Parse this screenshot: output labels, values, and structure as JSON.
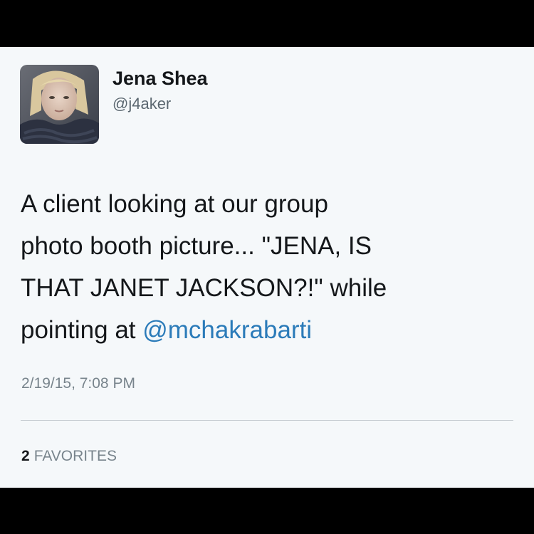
{
  "tweet": {
    "author_name": "Jena Shea",
    "author_handle": "@j4aker",
    "text_lines": [
      "A client looking at our group",
      "photo booth picture... \"JENA, IS",
      "THAT JANET JACKSON?!\" while",
      "pointing at "
    ],
    "mention": "@mchakrabarti",
    "timestamp": "2/19/15, 7:08 PM",
    "favorites_count": "2",
    "favorites_label": "FAVORITES"
  },
  "colors": {
    "background": "#000000",
    "card": "#f5f8fa",
    "text": "#14171a",
    "muted": "#78848c",
    "mention": "#2b7bb9"
  },
  "icons": {
    "avatar": "profile-photo-avatar"
  }
}
